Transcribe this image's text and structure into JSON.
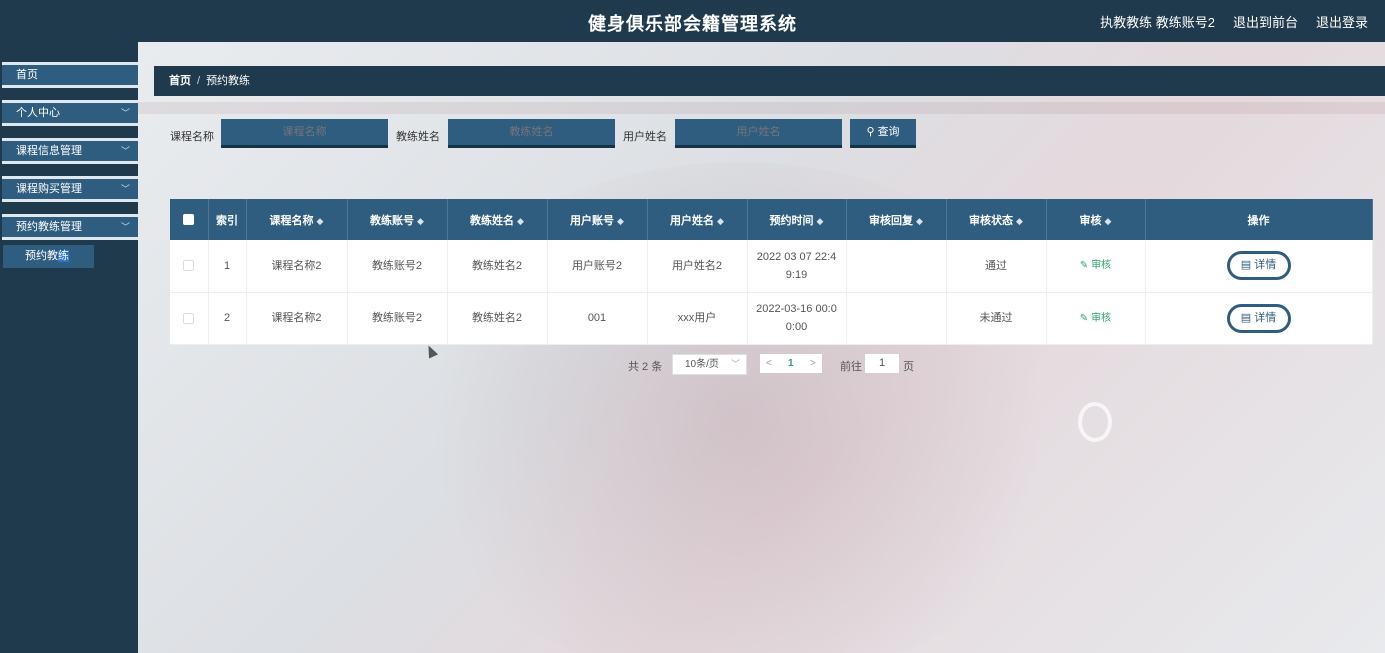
{
  "header": {
    "title": "健身俱乐部会籍管理系统",
    "user_info": "执教教练 教练账号2",
    "goto_front": "退出到前台",
    "logout": "退出登录"
  },
  "sidebar": {
    "items": [
      {
        "label": "首页"
      },
      {
        "label": "个人中心"
      },
      {
        "label": "课程信息管理"
      },
      {
        "label": "课程购买管理"
      },
      {
        "label": "预约教练管理"
      }
    ],
    "sub_items": [
      {
        "label_main": "预约教",
        "label_hl": "练"
      }
    ]
  },
  "breadcrumb": {
    "home": "首页",
    "separator": "/",
    "current": "预约教练"
  },
  "search": {
    "course_label": "课程名称",
    "course_placeholder": "课程名称",
    "coach_label": "教练姓名",
    "coach_placeholder": "教练姓名",
    "user_label": "用户姓名",
    "user_placeholder": "用户姓名",
    "button_label": "查询"
  },
  "table": {
    "headers": [
      "索引",
      "课程名称",
      "教练账号",
      "教练姓名",
      "用户账号",
      "用户姓名",
      "预约时间",
      "审核回复",
      "审核状态",
      "审核",
      "操作"
    ],
    "rows": [
      {
        "index": "1",
        "course": "课程名称2",
        "coach_account": "教练账号2",
        "coach_name": "教练姓名2",
        "user_account": "用户账号2",
        "user_name": "用户姓名2",
        "time": "2022 03 07 22:4 9:19",
        "reply": "",
        "status": "通过",
        "audit": "审核",
        "action": "详情"
      },
      {
        "index": "2",
        "course": "课程名称2",
        "coach_account": "教练账号2",
        "coach_name": "教练姓名2",
        "user_account": "001",
        "user_name": "xxx用户",
        "time": "2022-03-16 00:0 0:00",
        "reply": "",
        "status": "未通过",
        "audit": "审核",
        "action": "详情"
      }
    ]
  },
  "pagination": {
    "total": "共 2 条",
    "page_size": "10条/页",
    "prev": "<",
    "current_page": "1",
    "next": ">",
    "goto_label": "前往",
    "goto_value": "1",
    "page_suffix": "页"
  },
  "colors": {
    "nav_dark": "#1f3a4d",
    "accent": "#2f5d80",
    "success": "#2ca36a"
  }
}
